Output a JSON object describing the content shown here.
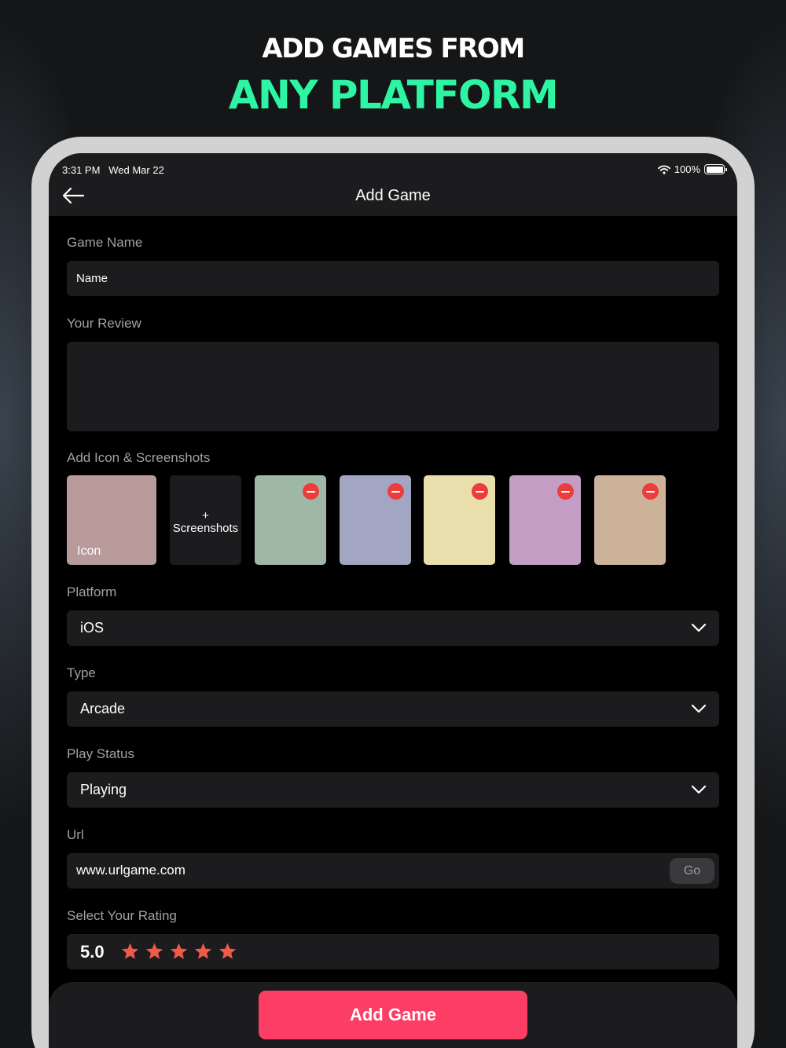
{
  "headline": {
    "line1": "ADD GAMES FROM",
    "line2": "ANY PLATFORM",
    "accent_color": "#2ef5a3"
  },
  "status_bar": {
    "time_date": "3:31 PM   Wed Mar 22",
    "battery_percent": "100%",
    "icons": [
      "wifi-icon",
      "battery-icon"
    ]
  },
  "nav": {
    "title": "Add Game",
    "back_icon": "arrow-left-icon"
  },
  "form": {
    "game_name": {
      "label": "Game Name",
      "value": "Name"
    },
    "review": {
      "label": "Your Review",
      "value": ""
    },
    "media": {
      "label": "Add Icon & Screenshots",
      "icon_label": "Icon",
      "icon_color": "#b89a9a",
      "add_screenshots_plus": "+",
      "add_screenshots_label": "Screenshots",
      "screenshot_colors": [
        "#9fb8a6",
        "#a3a6c2",
        "#e8dfad",
        "#c39dc3",
        "#cdb29a"
      ],
      "remove_icon": "minus-circle-icon"
    },
    "platform": {
      "label": "Platform",
      "value": "iOS"
    },
    "type": {
      "label": "Type",
      "value": "Arcade"
    },
    "play_status": {
      "label": "Play Status",
      "value": "Playing"
    },
    "url": {
      "label": "Url",
      "value": "www.urlgame.com",
      "go_label": "Go"
    },
    "rating": {
      "label": "Select Your Rating",
      "value": "5.0",
      "stars_filled": 5,
      "stars_total": 5,
      "star_color": "#f05a48"
    }
  },
  "submit": {
    "label": "Add Game",
    "color": "#fc3d64"
  }
}
